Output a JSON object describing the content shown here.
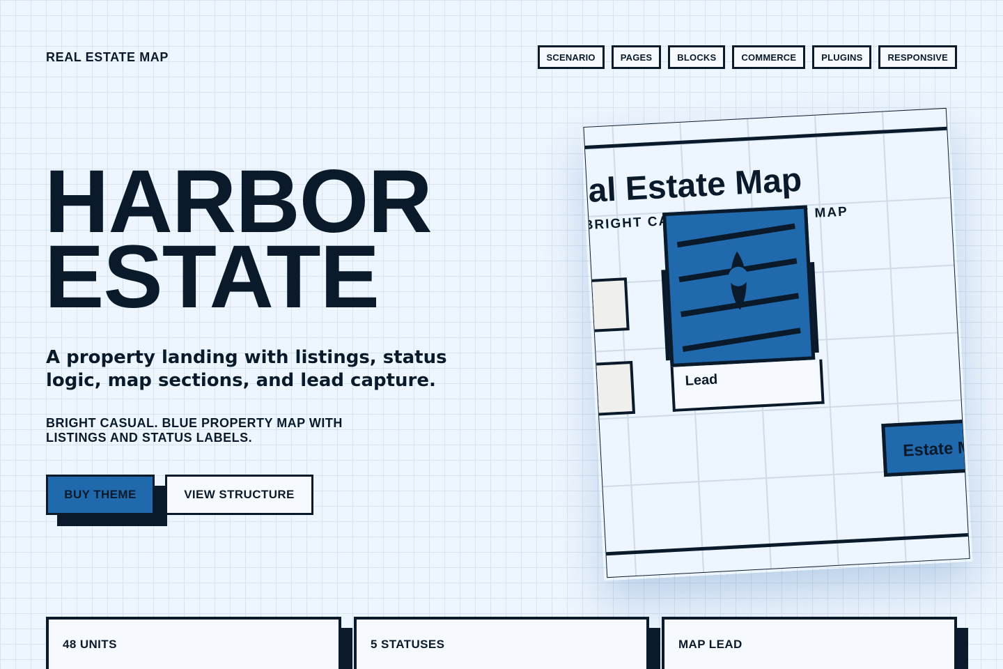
{
  "brand": {
    "name": "REAL ESTATE MAP"
  },
  "nav": {
    "items": [
      {
        "label": "SCENARIO"
      },
      {
        "label": "PAGES"
      },
      {
        "label": "BLOCKS"
      },
      {
        "label": "COMMERCE"
      },
      {
        "label": "PLUGINS"
      },
      {
        "label": "RESPONSIVE"
      }
    ]
  },
  "hero": {
    "title_line1": "HARBOR",
    "title_line2": "ESTATE",
    "subtitle": "A property landing with listings, status logic, map sections, and lead capture.",
    "tagline": "BRIGHT CASUAL. BLUE PROPERTY MAP WITH LISTINGS AND STATUS LABELS.",
    "primary_button": "BUY THEME",
    "secondary_button": "VIEW STRUCTURE"
  },
  "preview": {
    "title": "Real Estate Map",
    "subtitle": "BRIGHT CASUAL / PROPERTY MAP",
    "lead_label": "Lead",
    "estate_tag": "Estate Map"
  },
  "stats": [
    {
      "label": "48 UNITS"
    },
    {
      "label": "5 STATUSES"
    },
    {
      "label": "MAP LEAD"
    }
  ],
  "colors": {
    "background": "#edf5fe",
    "ink": "#0b1a2b",
    "accent": "#2069ad",
    "panel": "#f6faff"
  }
}
